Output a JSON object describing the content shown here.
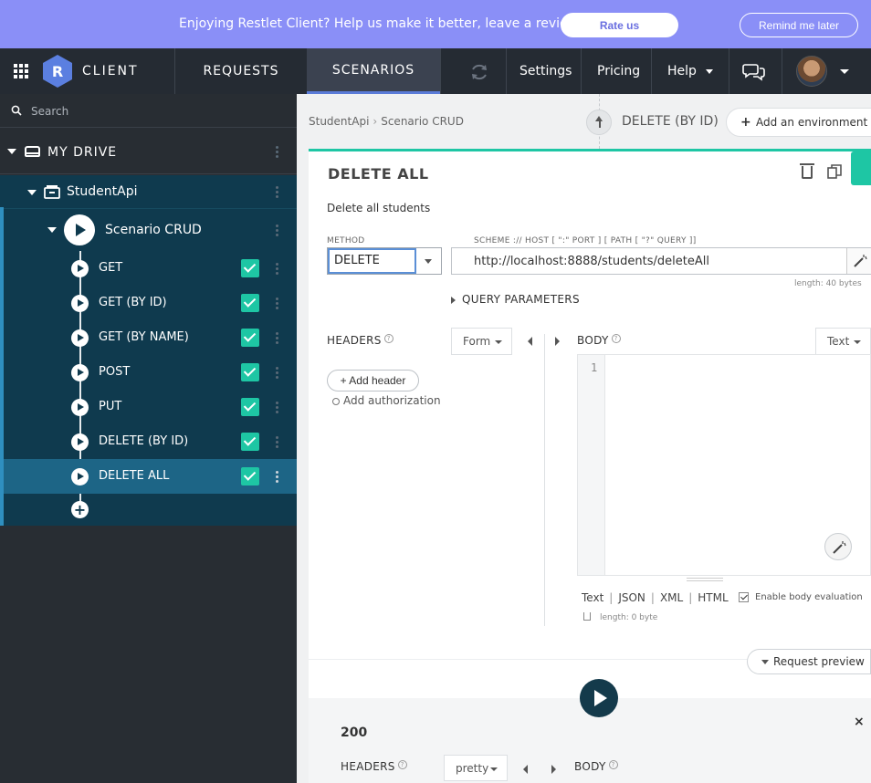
{
  "banner": {
    "message": "Enjoying Restlet Client? Help us make it better, leave a review!",
    "rate_label": "Rate us",
    "remind_label": "Remind me later"
  },
  "topnav": {
    "logo_letter": "R",
    "app_name": "CLIENT",
    "tabs": [
      {
        "label": "REQUESTS"
      },
      {
        "label": "SCENARIOS"
      }
    ],
    "settings_label": "Settings",
    "pricing_label": "Pricing",
    "help_label": "Help"
  },
  "sidebar": {
    "search_placeholder": "Search",
    "drive_label": "MY DRIVE",
    "project_label": "StudentApi",
    "scenario_label": "Scenario CRUD",
    "requests": [
      {
        "label": "GET",
        "checked": true
      },
      {
        "label": "GET (BY ID)",
        "checked": true
      },
      {
        "label": "GET (BY NAME)",
        "checked": true
      },
      {
        "label": "POST",
        "checked": true
      },
      {
        "label": "PUT",
        "checked": true
      },
      {
        "label": "DELETE (BY ID)",
        "checked": true
      },
      {
        "label": "DELETE ALL",
        "checked": true
      }
    ],
    "add_symbol": "+"
  },
  "main": {
    "breadcrumb": [
      "StudentApi",
      "Scenario CRUD"
    ],
    "breadcrumb_sep": "›",
    "previous_request": "DELETE (BY ID)",
    "env_label": "Add an environment",
    "request": {
      "title": "DELETE ALL",
      "description": "Delete all students",
      "method_label": "METHOD",
      "method_value": "DELETE",
      "url_label": "SCHEME :// HOST [ \":\" PORT ] [ PATH [ \"?\" QUERY ]]",
      "url_value": "http://localhost:8888/students/deleteAll",
      "url_length": "length: 40 bytes",
      "query_params_label": "QUERY PARAMETERS",
      "headers_label": "HEADERS",
      "headers_mode": "Form",
      "add_header_label": "+ Add header",
      "add_auth_label": "Add authorization",
      "body_label": "BODY",
      "body_mode": "Text",
      "body_line_number": "1",
      "body_formats": [
        "Text",
        "JSON",
        "XML",
        "HTML"
      ],
      "enable_eval_label": "Enable body evaluation",
      "body_length": "length: 0 byte",
      "request_preview_label": "Request preview"
    },
    "response": {
      "status": "200",
      "headers_label": "HEADERS",
      "headers_mode": "pretty",
      "body_label": "BODY",
      "close_symbol": "×"
    }
  }
}
